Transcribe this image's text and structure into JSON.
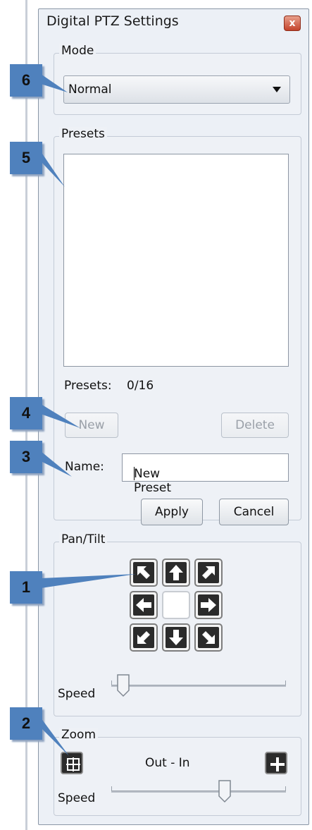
{
  "window": {
    "title": "Digital PTZ Settings",
    "close_glyph": "x"
  },
  "mode": {
    "label": "Mode",
    "selected": "Normal"
  },
  "presets": {
    "label": "Presets",
    "count_label": "Presets:",
    "count_value": "0/16",
    "new_label": "New",
    "delete_label": "Delete",
    "name_label": "Name:",
    "name_value": "New Preset",
    "apply_label": "Apply",
    "cancel_label": "Cancel"
  },
  "pantilt": {
    "label": "Pan/Tilt",
    "speed_label": "Speed",
    "speed_level": 0.07
  },
  "zoom": {
    "label": "Zoom",
    "center_label": "Out - In",
    "speed_label": "Speed",
    "speed_level": 0.65
  },
  "callouts": [
    "6",
    "5",
    "4",
    "3",
    "1",
    "2"
  ],
  "colors": {
    "callout": "#4f81bd",
    "window_bg": "#ecf0f6"
  }
}
